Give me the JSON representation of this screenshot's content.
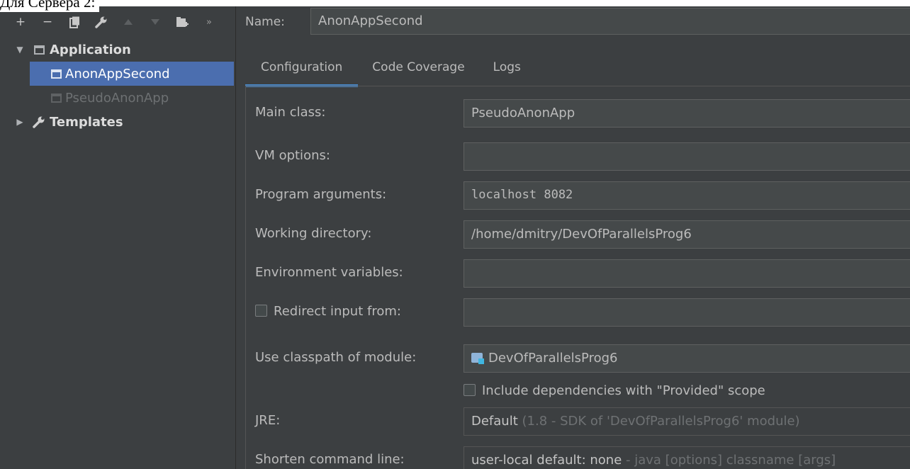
{
  "caption": "Для Сервера 2:",
  "toolbar": {
    "add": "+",
    "remove": "−",
    "copy": "⎘",
    "edit": "🔧",
    "up": "▲",
    "down": "▼",
    "folder": "▪",
    "more": "»"
  },
  "tree": {
    "application_label": "Application",
    "items": [
      {
        "label": "AnonAppSecond",
        "selected": true
      },
      {
        "label": "PseudoAnonApp",
        "selected": false
      }
    ],
    "templates_label": "Templates"
  },
  "name": {
    "label": "Name:",
    "value": "AnonAppSecond"
  },
  "tabs": [
    {
      "label": "Configuration",
      "active": true
    },
    {
      "label": "Code Coverage",
      "active": false
    },
    {
      "label": "Logs",
      "active": false
    }
  ],
  "form": {
    "main_class": {
      "label": "Main class:",
      "value": "PseudoAnonApp"
    },
    "vm_options": {
      "label": "VM options:",
      "value": ""
    },
    "program_arguments": {
      "label": "Program arguments:",
      "value": "localhost 8082"
    },
    "working_directory": {
      "label": "Working directory:",
      "value": "/home/dmitry/DevOfParallelsProg6"
    },
    "environment_variables": {
      "label": "Environment variables:",
      "value": ""
    },
    "redirect_input": {
      "label": "Redirect input from:",
      "checked": false,
      "value": ""
    },
    "classpath_module": {
      "label": "Use classpath of module:",
      "value": "DevOfParallelsProg6"
    },
    "include_provided": {
      "label": "Include dependencies with \"Provided\" scope",
      "checked": false
    },
    "jre": {
      "label": "JRE:",
      "value": "Default",
      "hint": "(1.8 - SDK of 'DevOfParallelsProg6' module)"
    },
    "shorten_command_line": {
      "label": "Shorten command line:",
      "value": "user-local default: none",
      "hint": "- java [options] classname [args]"
    }
  },
  "colors": {
    "background": "#3c3f41",
    "selection": "#4b6eaf",
    "tab_underline": "#4a88c7",
    "field_background": "#45494a"
  }
}
